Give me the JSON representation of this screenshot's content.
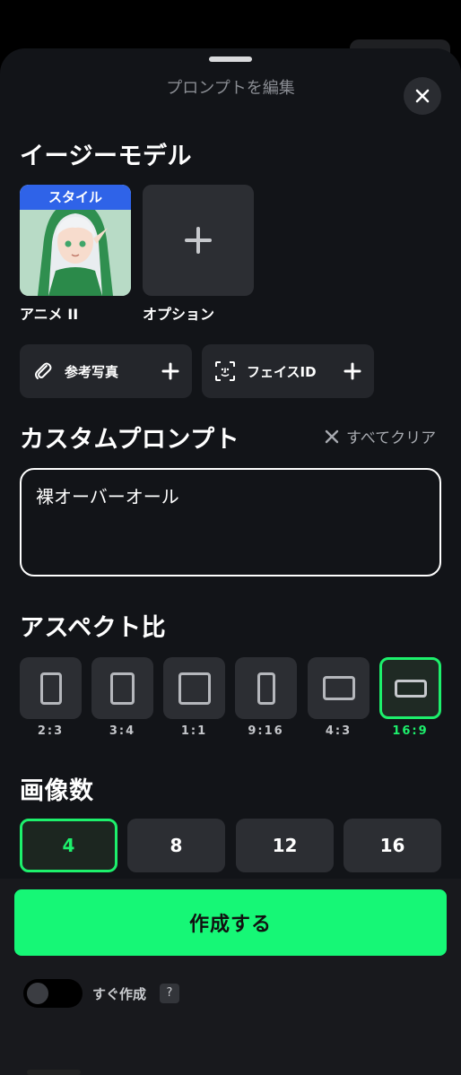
{
  "header": {
    "title": "プロンプトを編集",
    "close_icon": "close-icon"
  },
  "easy_model": {
    "section_title": "イージーモデル",
    "selected": {
      "badge": "スタイル",
      "label": "アニメ II"
    },
    "add_option": {
      "label": "オプション",
      "icon": "plus-icon"
    }
  },
  "reference": {
    "photo": {
      "label": "参考写真",
      "icon": "paperclip-icon"
    },
    "face_id": {
      "label": "フェイスID",
      "icon": "face-scan-icon"
    }
  },
  "custom_prompt": {
    "section_title": "カスタムプロンプト",
    "clear_all": "すべてクリア",
    "value": "裸オーバーオール"
  },
  "aspect_ratio": {
    "section_title": "アスペクト比",
    "options": [
      "2:3",
      "3:4",
      "1:1",
      "9:16",
      "4:3",
      "16:9"
    ],
    "selected": "16:9"
  },
  "image_count": {
    "section_title": "画像数",
    "options": [
      "4",
      "8",
      "12",
      "16"
    ],
    "selected": "4"
  },
  "actions": {
    "create": "作成する",
    "instant_create": "すぐ作成",
    "instant_create_enabled": false,
    "help": "?"
  },
  "colors": {
    "accent": "#16f776",
    "selected_border": "#1df06c",
    "sheet_bg": "#121418",
    "badge_blue": "#2f63e8"
  }
}
